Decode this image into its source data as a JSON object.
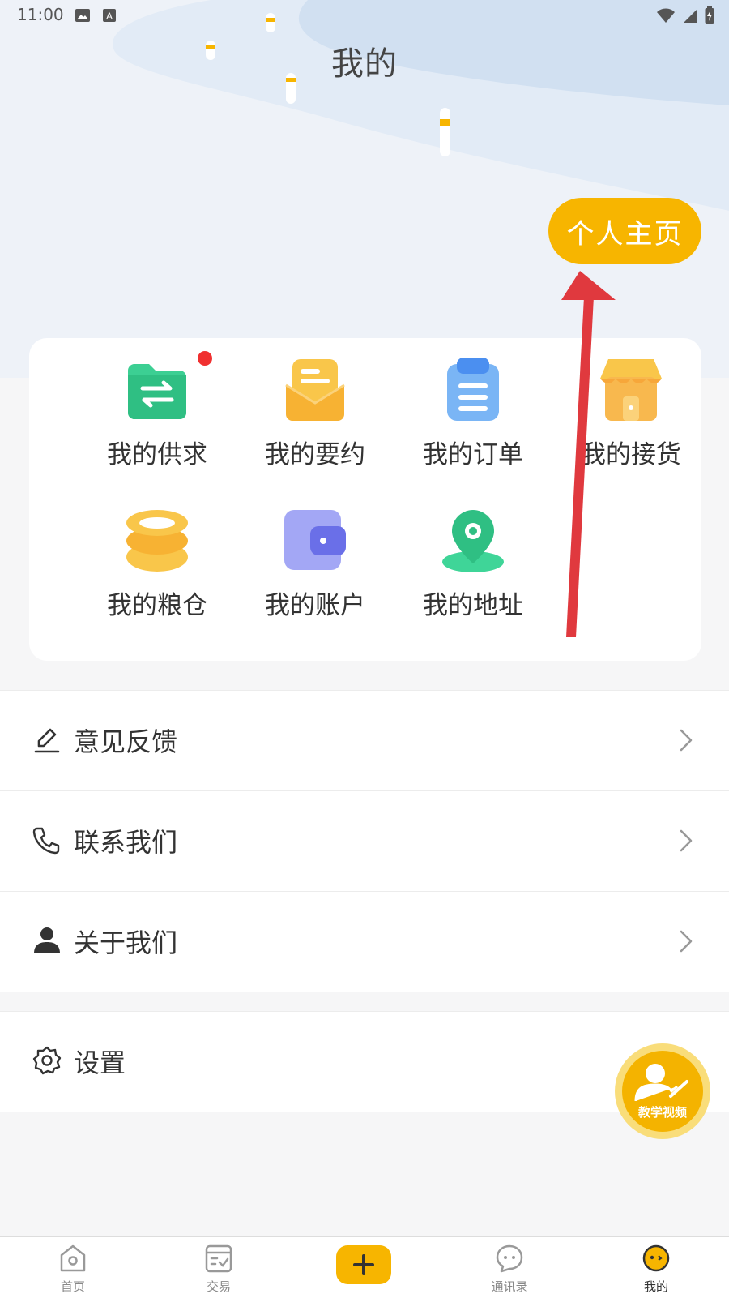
{
  "status_bar": {
    "time": "11:00"
  },
  "header": {
    "title": "我的",
    "home_button": "个人主页"
  },
  "grid": [
    {
      "label": "我的供求",
      "icon": "supply-demand-icon",
      "badge": true
    },
    {
      "label": "我的要约",
      "icon": "offer-envelope-icon",
      "badge": false
    },
    {
      "label": "我的订单",
      "icon": "order-clipboard-icon",
      "badge": false
    },
    {
      "label": "我的接货",
      "icon": "receive-store-icon",
      "badge": false
    },
    {
      "label": "我的粮仓",
      "icon": "granary-stack-icon",
      "badge": false
    },
    {
      "label": "我的账户",
      "icon": "wallet-icon",
      "badge": false
    },
    {
      "label": "我的地址",
      "icon": "location-pin-icon",
      "badge": false
    }
  ],
  "menu": [
    {
      "label": "意见反馈",
      "icon": "edit-pen-icon"
    },
    {
      "label": "联系我们",
      "icon": "phone-icon"
    },
    {
      "label": "关于我们",
      "icon": "person-icon"
    }
  ],
  "settings": {
    "label": "设置",
    "icon": "gear-icon"
  },
  "floating": {
    "label": "教学视频"
  },
  "tabs": [
    {
      "label": "首页",
      "icon": "home-icon"
    },
    {
      "label": "交易",
      "icon": "trade-icon"
    },
    {
      "label": "",
      "icon": "add-icon"
    },
    {
      "label": "通讯录",
      "icon": "contacts-chat-icon"
    },
    {
      "label": "我的",
      "icon": "mine-face-icon",
      "active": true
    }
  ],
  "colors": {
    "accent": "#f7b500",
    "annotation_arrow": "#e0393e"
  }
}
